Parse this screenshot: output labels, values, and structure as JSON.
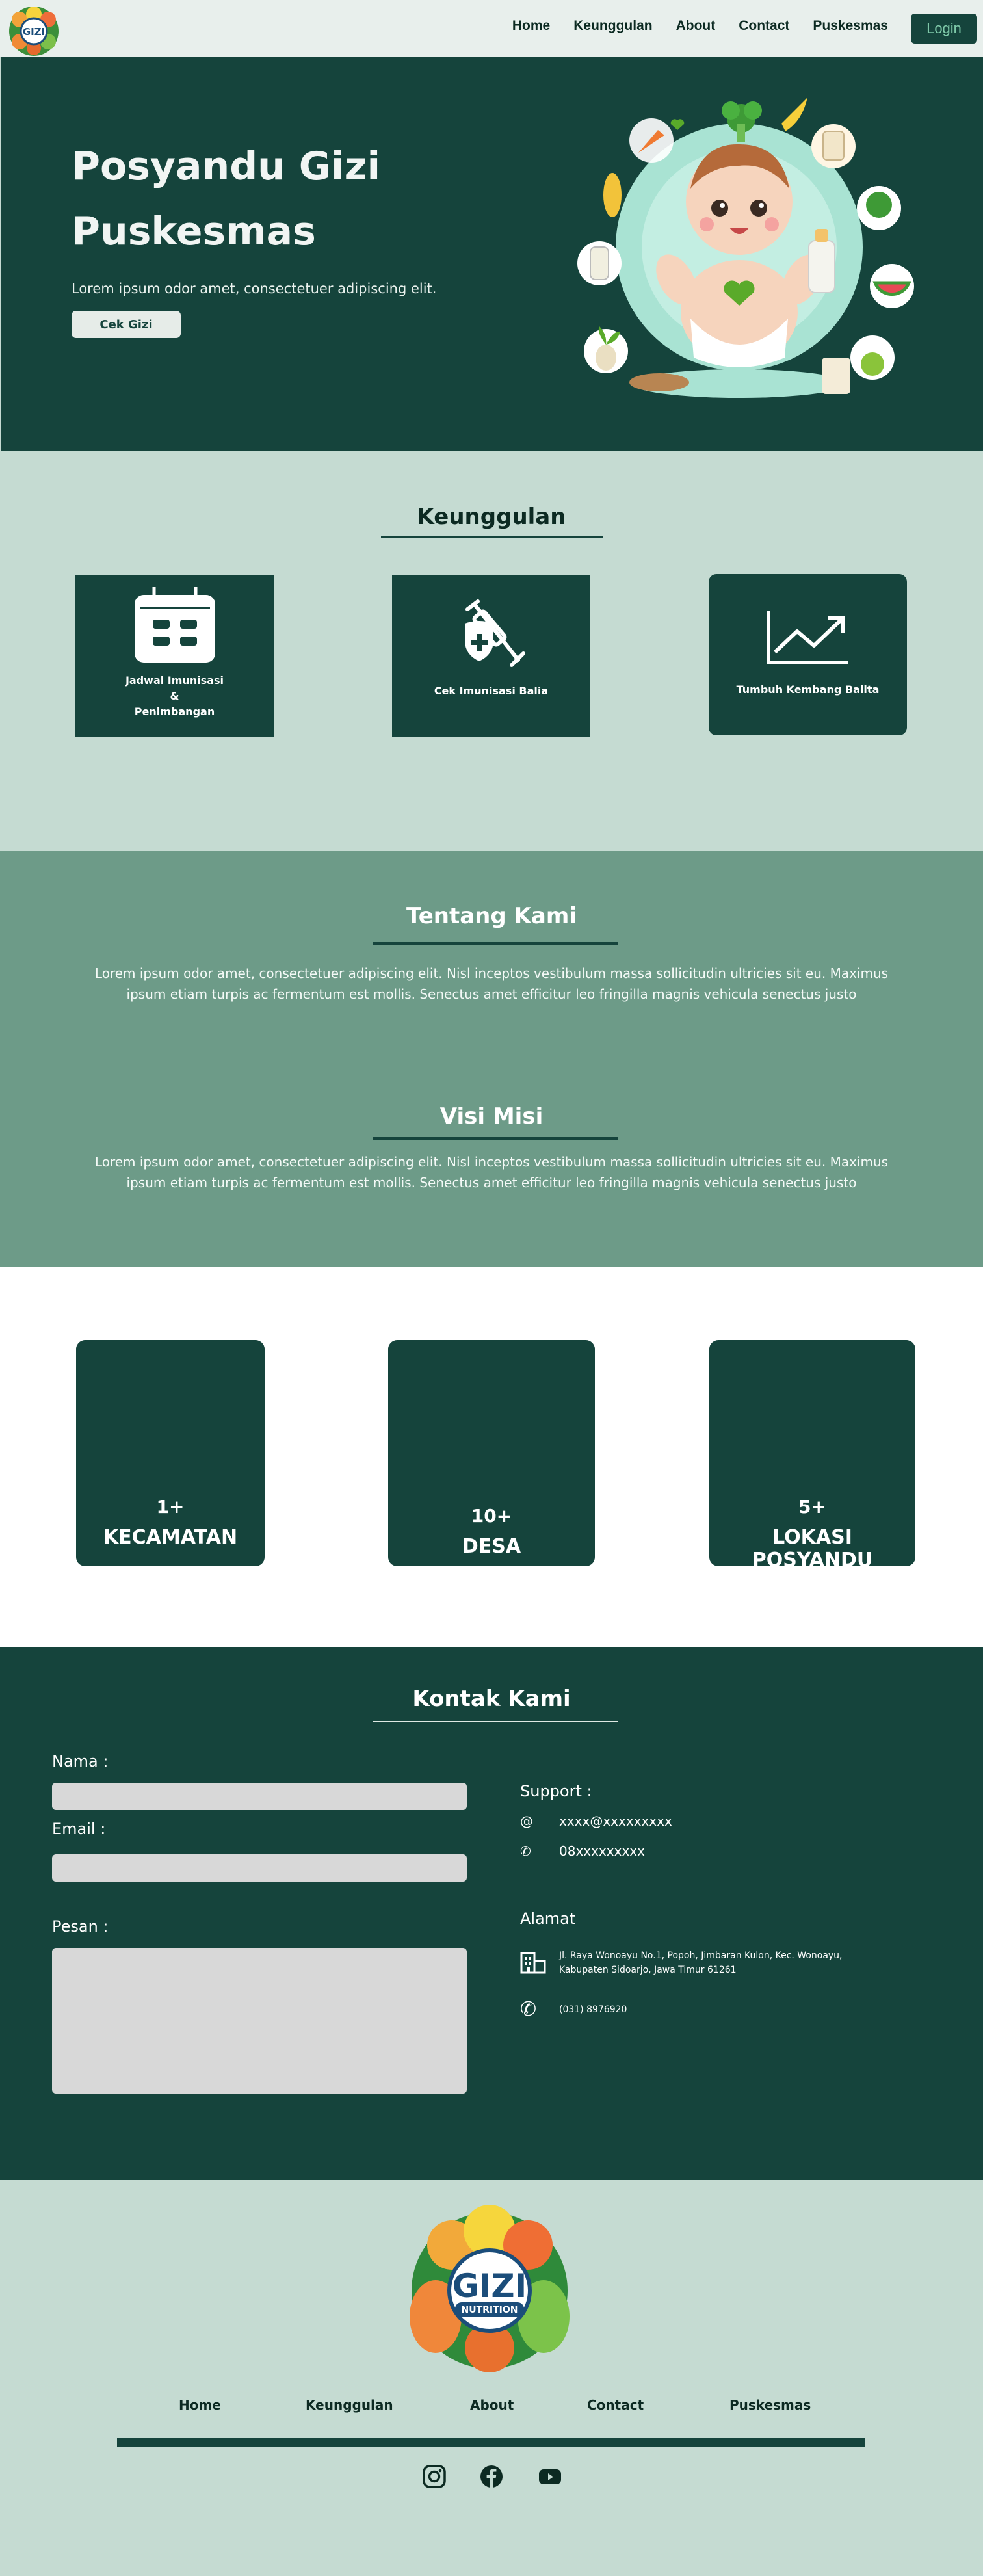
{
  "nav": {
    "logo_text": "GIZI",
    "links": [
      "Home",
      "Keunggulan",
      "About",
      "Contact",
      "Puskesmas"
    ],
    "login": "Login"
  },
  "hero": {
    "title": "Posyandu Gizi Puskesmas",
    "subtitle": "Lorem ipsum odor amet, consectetuer adipiscing elit.",
    "button": "Cek Gizi"
  },
  "keunggulan": {
    "title": "Keunggulan",
    "cards": [
      {
        "icon": "calendar-icon",
        "label_lines": [
          "Jadwal Imunisasi",
          "&",
          "Penimbangan"
        ]
      },
      {
        "icon": "vaccine-icon",
        "label": "Cek Imunisasi Balia"
      },
      {
        "icon": "growth-chart-icon",
        "label": "Tumbuh Kembang Balita"
      }
    ]
  },
  "about": {
    "title": "Tentang Kami",
    "text": "Lorem ipsum odor amet, consectetuer adipiscing elit. Nisl inceptos vestibulum massa sollicitudin ultricies sit eu. Maximus ipsum etiam turpis ac fermentum est mollis. Senectus amet efficitur leo fringilla magnis vehicula senectus justo",
    "visi_title": "Visi Misi",
    "visi_text": "Lorem ipsum odor amet, consectetuer adipiscing elit. Nisl inceptos vestibulum massa sollicitudin ultricies sit eu. Maximus ipsum etiam turpis ac fermentum est mollis. Senectus amet efficitur leo fringilla magnis vehicula senectus justo"
  },
  "stats": [
    {
      "num": "1+",
      "name": "KECAMATAN"
    },
    {
      "num": "10+",
      "name": "DESA"
    },
    {
      "num": "5+",
      "name": "LOKASI POSYANDU"
    }
  ],
  "contact": {
    "title": "Kontak Kami",
    "nama_label": "Nama :",
    "email_label": "Email :",
    "pesan_label": "Pesan :",
    "support_label": "Support :",
    "email": "xxxx@xxxxxxxxx",
    "phone": "08xxxxxxxxx",
    "alamat_label": "Alamat",
    "address": "Jl. Raya Wonoayu No.1, Popoh, Jimbaran Kulon, Kec. Wonoayu, Kabupaten Sidoarjo, Jawa Timur 61261",
    "office_phone": "(031) 8976920"
  },
  "footer": {
    "logo_text": "GIZI",
    "logo_sub": "NUTRITION",
    "links": [
      "Home",
      "Keunggulan",
      "About",
      "Contact",
      "Puskesmas"
    ],
    "social": [
      "instagram-icon",
      "facebook-icon",
      "youtube-icon"
    ]
  },
  "colors": {
    "primary": "#15443c",
    "light": "#c5dbd2",
    "mid": "#6d9b88"
  }
}
